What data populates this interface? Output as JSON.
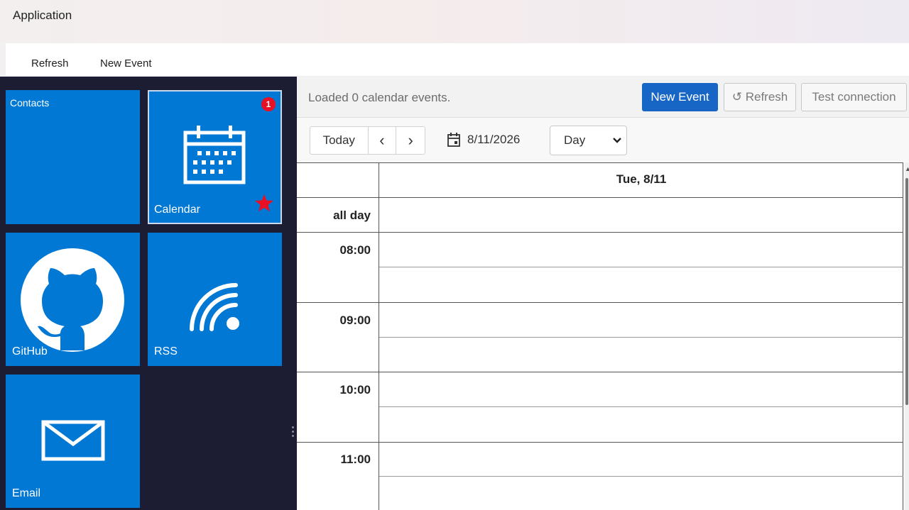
{
  "window": {
    "title": "Application"
  },
  "menu": {
    "refresh": "Refresh",
    "new_event": "New Event"
  },
  "tiles": {
    "contacts": "Contacts",
    "calendar": "Calendar",
    "calendar_badge": "1",
    "github": "GitHub",
    "rss": "RSS",
    "email": "Email"
  },
  "toolbar": {
    "status": "Loaded 0 calendar events.",
    "new_event": "New Event",
    "refresh": "↺ Refresh",
    "test_connection": "Test connection"
  },
  "nav": {
    "today": "Today",
    "prev": "‹",
    "next": "›",
    "date": "8/11/2026",
    "view": "Day"
  },
  "calendar": {
    "day_header": "Tue, 8/11",
    "all_day": "all day",
    "hours": [
      "08:00",
      "09:00",
      "10:00",
      "11:00"
    ]
  },
  "colors": {
    "tile": "#0078d4",
    "primary_button": "#1766c5",
    "badge": "#e81123",
    "sidebar": "#1c1d33"
  }
}
